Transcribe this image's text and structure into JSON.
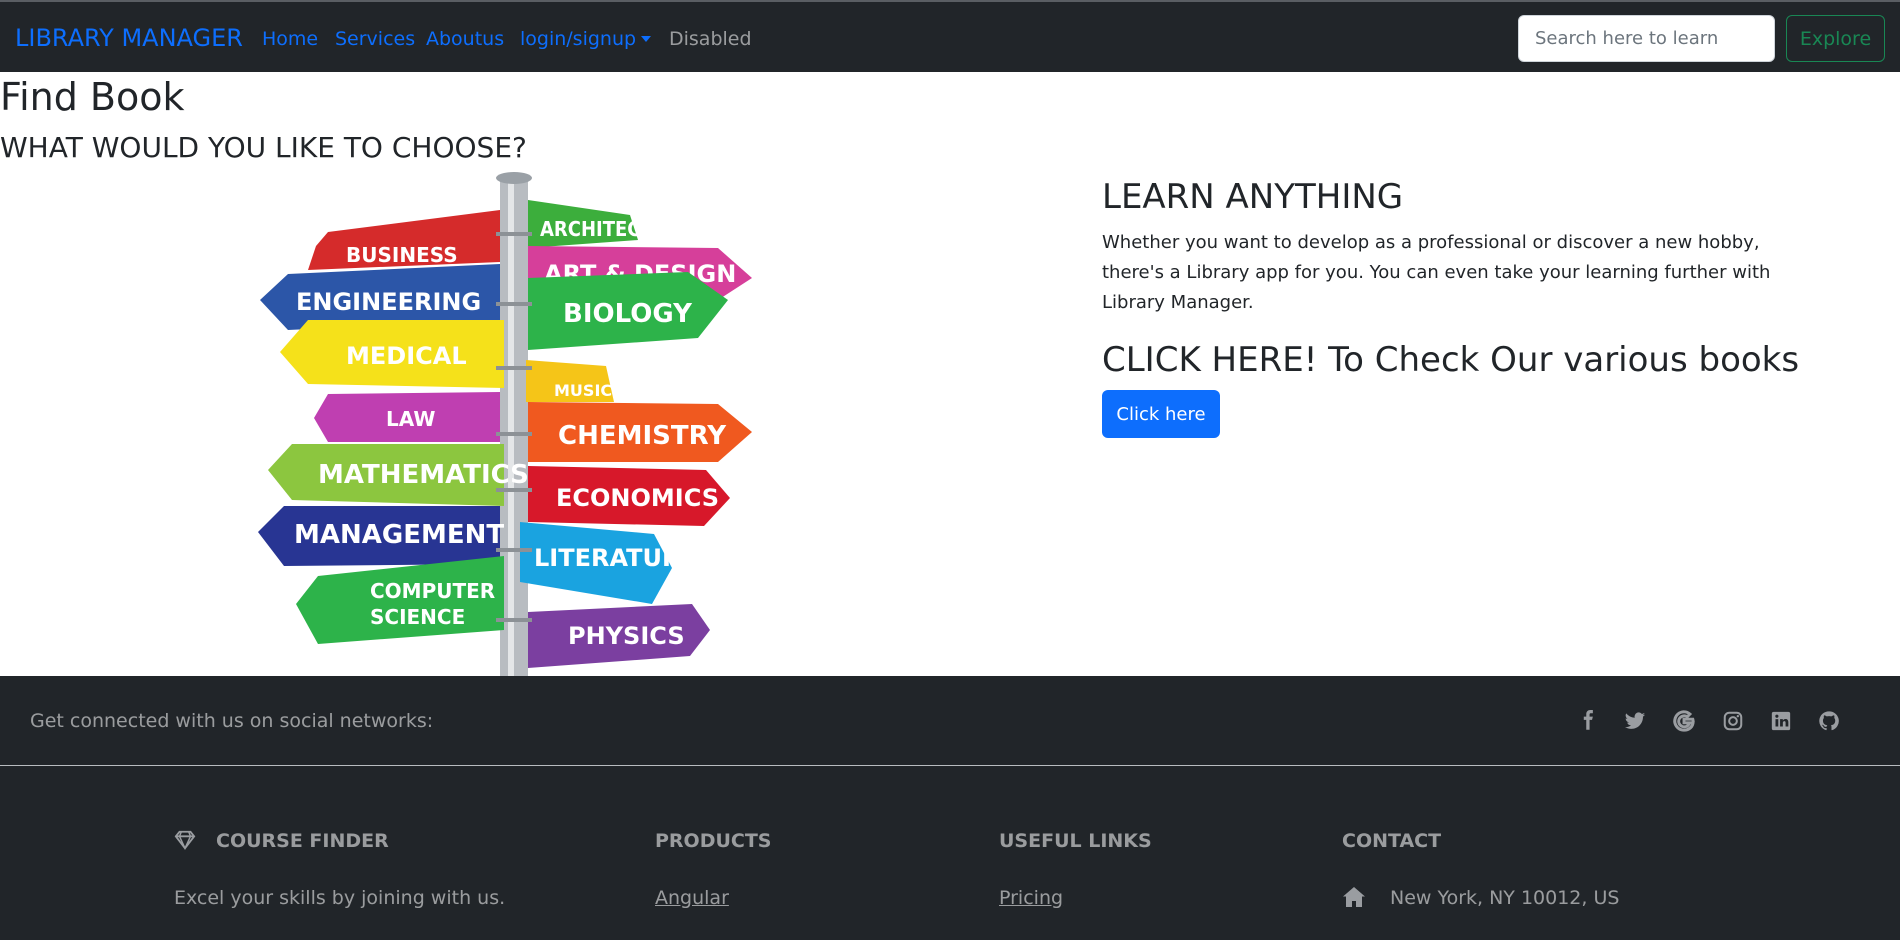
{
  "navbar": {
    "brand": "LIBRARY MANAGER",
    "links": [
      {
        "label": "Home"
      },
      {
        "label": "Services"
      },
      {
        "label": "Aboutus"
      },
      {
        "label": "login/signup"
      },
      {
        "label": "Disabled"
      }
    ],
    "search_placeholder": "Search here to learn",
    "search_value": "",
    "explore_label": "Explore"
  },
  "main": {
    "title": "Find Book",
    "subtitle": "WHAT WOULD YOU LIKE TO CHOOSE?",
    "signpost": {
      "left_signs": [
        "BUSINESS",
        "ENGINEERING",
        "MEDICAL",
        "LAW",
        "MATHEMATICS",
        "MANAGEMENT",
        "COMPUTER",
        "SCIENCE"
      ],
      "right_signs": [
        "ARCHITECTURE",
        "ART & DESIGN",
        "BIOLOGY",
        "MUSIC",
        "CHEMISTRY",
        "ECONOMICS",
        "LITERATURE",
        "PHYSICS"
      ]
    },
    "learn_title": "LEARN ANYTHING",
    "learn_text": "Whether you want to develop as a professional or discover a new hobby, there's a Library app for you. You can even take your learning further with Library Manager.",
    "cta_title": "CLICK HERE! To Check Our various books",
    "cta_button": "Click here"
  },
  "footer": {
    "social_text": "Get connected with us on social networks:",
    "social_icons": [
      "facebook-icon",
      "twitter-icon",
      "google-icon",
      "instagram-icon",
      "linkedin-icon",
      "github-icon"
    ],
    "columns": {
      "company_title": "COURSE FINDER",
      "company_text": "Excel your skills by joining with us.",
      "products_title": "PRODUCTS",
      "products_link": "Angular",
      "links_title": "USEFUL LINKS",
      "links_link": "Pricing",
      "contact_title": "CONTACT",
      "contact_address": "New York, NY 10012, US"
    }
  },
  "colors": {
    "navbar_bg": "#212529",
    "primary": "#0d6efd",
    "success": "#198754",
    "muted_text": "rgba(255,255,255,0.55)"
  }
}
